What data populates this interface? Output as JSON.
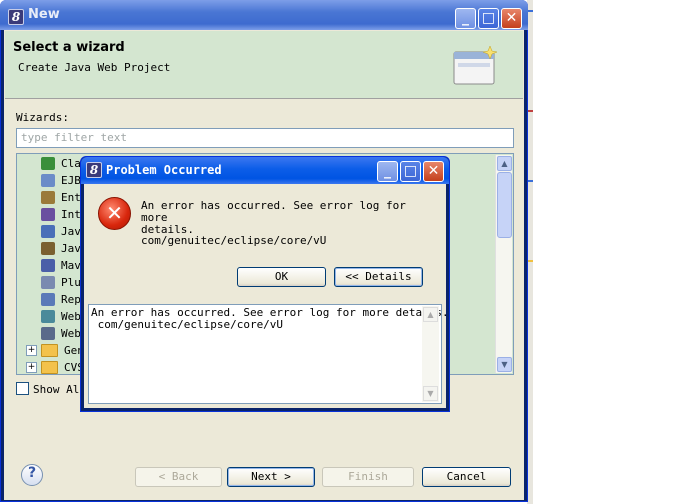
{
  "main_window": {
    "title": "New",
    "app_icon_glyph": "8",
    "header_title": "Select a wizard",
    "header_description": "Create Java Web Project",
    "wizards_label": "Wizards:",
    "filter_placeholder": "type filter text",
    "tree_items": [
      {
        "label": "Cla",
        "icon": "class-icon",
        "color": "#3a8f3a"
      },
      {
        "label": "EJB",
        "icon": "ejb-icon",
        "color": "#6b8cc8"
      },
      {
        "label": "Ent",
        "icon": "entity-icon",
        "color": "#9a7a3a"
      },
      {
        "label": "Int",
        "icon": "interface-icon",
        "color": "#6a4fa0"
      },
      {
        "label": "Jav",
        "icon": "java-icon",
        "color": "#4a6fb8"
      },
      {
        "label": "Jav",
        "icon": "java-icon",
        "color": "#7a6030"
      },
      {
        "label": "Mav",
        "icon": "maven-icon",
        "color": "#4a5fa8"
      },
      {
        "label": "Plu",
        "icon": "plugin-icon",
        "color": "#7a8ab0"
      },
      {
        "label": "Rep",
        "icon": "report-icon",
        "color": "#5a7ab8"
      },
      {
        "label": "Web",
        "icon": "web-icon",
        "color": "#4a8a9a"
      },
      {
        "label": "Web",
        "icon": "web-service-icon",
        "color": "#5a6a8a"
      },
      {
        "label": "Gen",
        "icon": "folder-icon",
        "color": "#f3c24b",
        "expandable": true
      },
      {
        "label": "CVS",
        "icon": "folder-icon",
        "color": "#f3c24b",
        "expandable": true
      }
    ],
    "show_all_label": "Show All",
    "help_glyph": "?",
    "buttons": {
      "back": "< Back",
      "next": "Next >",
      "finish": "Finish",
      "cancel": "Cancel"
    }
  },
  "dialog": {
    "title": "Problem Occurred",
    "message": "An error has occurred. See error log for more\ndetails.",
    "path": "com/genuitec/eclipse/core/vU",
    "ok_label": "OK",
    "details_label": "<< Details",
    "details_text": "An error has occurred. See error log for more details.\n com/genuitec/eclipse/core/vU",
    "error_glyph": "✕"
  },
  "colors": {
    "title_bar": "#3e6bcf",
    "dialog_title_bar": "#0054e3",
    "header_bg": "#d4e6d0",
    "client_bg": "#ece9d8",
    "error_red": "#d8260c"
  }
}
